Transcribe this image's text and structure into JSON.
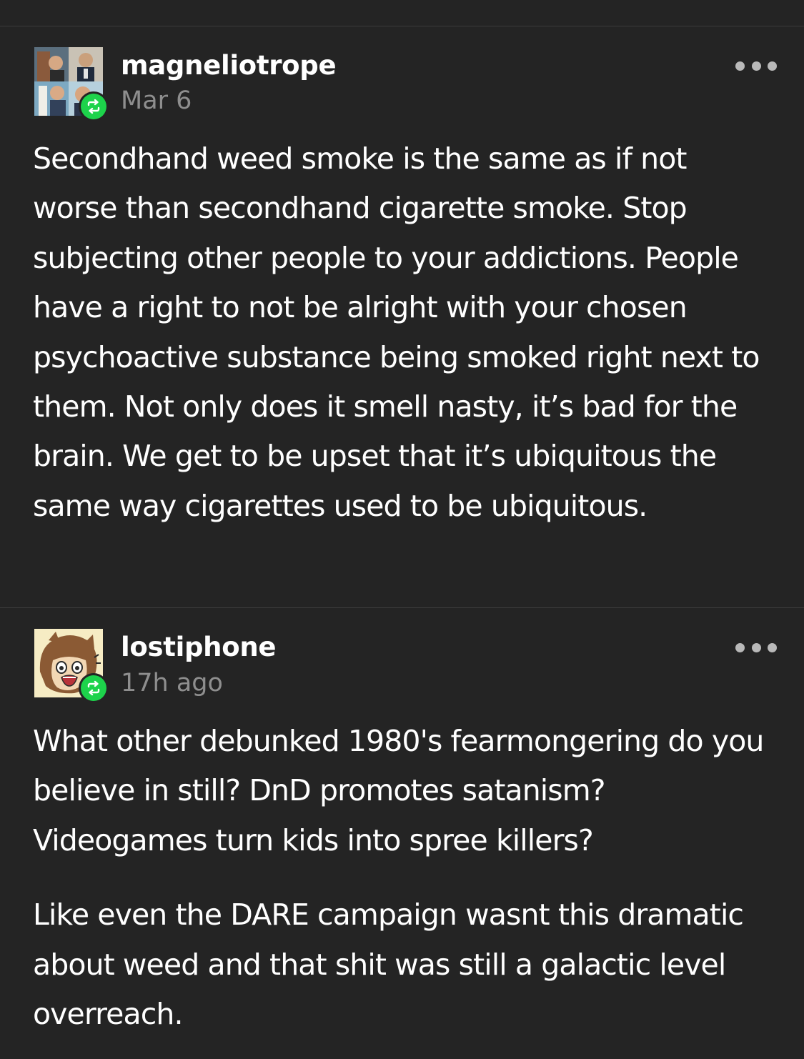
{
  "posts": [
    {
      "username": "magneliotrope",
      "timestamp": "Mar 6",
      "avatar_icon": "collage-avatar",
      "reblog_icon": "reblog-icon",
      "menu_icon": "more-options-icon",
      "paragraphs": [
        "Secondhand weed smoke is the same as if not worse than secondhand cigarette smoke. Stop subjecting other people to your addictions. People have a right to not be alright with your chosen psychoactive substance being smoked right next to them. Not only does it smell nasty, it’s bad for the brain. We get to be upset that it’s ubiquitous the same way cigarettes used to be ubiquitous."
      ]
    },
    {
      "username": "lostiphone",
      "timestamp": "17h ago",
      "avatar_icon": "cartoon-avatar",
      "reblog_icon": "reblog-icon",
      "menu_icon": "more-options-icon",
      "paragraphs": [
        "What other debunked 1980's fearmongering do you believe in still? DnD promotes satanism? Videogames turn kids into spree killers?",
        "Like even the DARE campaign wasnt this dramatic about weed and that shit was still a galactic level overreach."
      ]
    }
  ],
  "colors": {
    "background": "#242424",
    "divider": "#3c3c3c",
    "text": "#ffffff",
    "muted": "#8e8e8e",
    "reblog_green": "#1dd34b"
  }
}
